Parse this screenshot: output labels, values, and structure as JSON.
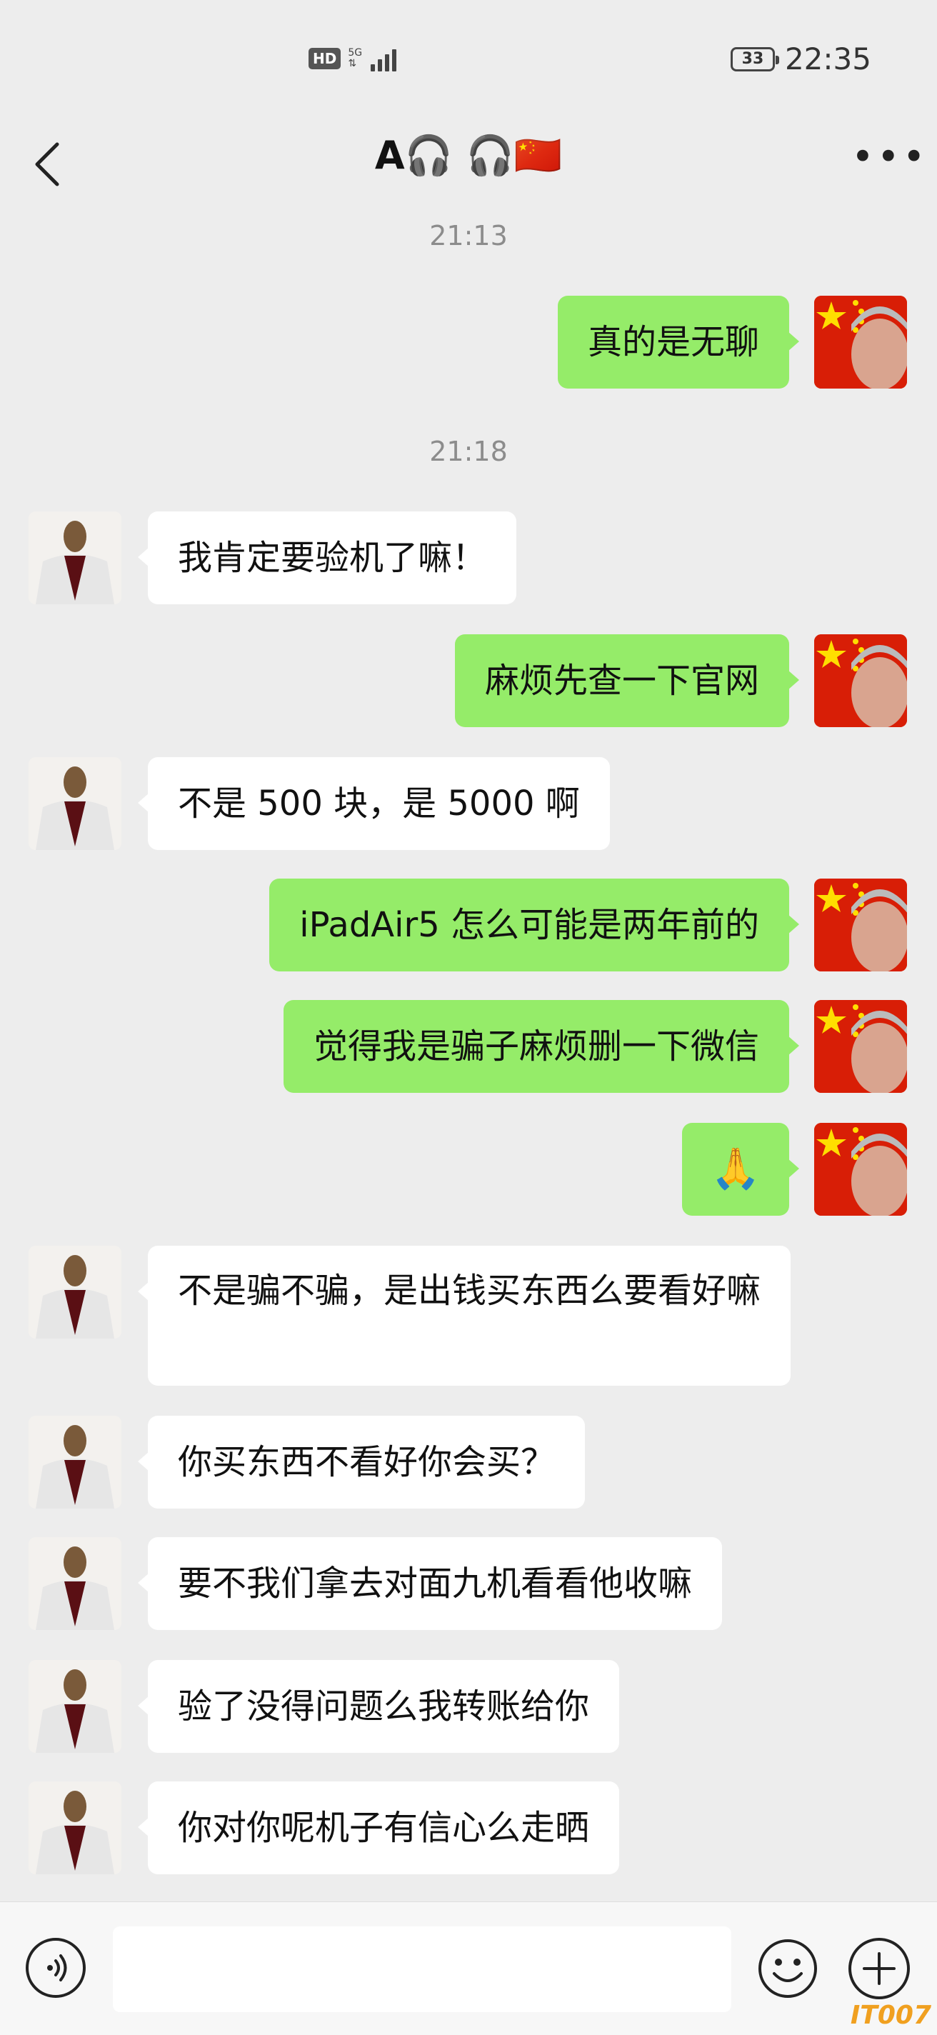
{
  "status_bar": {
    "hd": "HD",
    "network": "5G",
    "battery": "33",
    "time": "22:35"
  },
  "header": {
    "title": "A🎧 🎧🇨🇳"
  },
  "icons": {
    "back": "chevron-left-icon",
    "more": "more-icon",
    "voice": "voice-icon",
    "emoji": "emoji-icon",
    "plus": "plus-icon"
  },
  "colors": {
    "background": "#ededed",
    "me_bubble": "#95ec69",
    "them_bubble": "#ffffff"
  },
  "timestamps": [
    "21:13",
    "21:18"
  ],
  "messages": [
    {
      "from": "me",
      "text": "真的是无聊"
    },
    {
      "from": "them",
      "text": "我肯定要验机了嘛！"
    },
    {
      "from": "me",
      "text": "麻烦先查一下官网"
    },
    {
      "from": "them",
      "text": "不是 500 块，是 5000 啊"
    },
    {
      "from": "me",
      "text": "iPadAir5 怎么可能是两年前的"
    },
    {
      "from": "me",
      "text": "觉得我是骗子麻烦删一下微信"
    },
    {
      "from": "me",
      "text": "🙏"
    },
    {
      "from": "them",
      "text": "不是骗不骗，是出钱买东西么要看好嘛"
    },
    {
      "from": "them",
      "text": "你买东西不看好你会买？"
    },
    {
      "from": "them",
      "text": "要不我们拿去对面九机看看他收嘛"
    },
    {
      "from": "them",
      "text": "验了没得问题么我转账给你"
    },
    {
      "from": "them",
      "text": "你对你呢机子有信心么走晒"
    }
  ],
  "watermark": "IT007"
}
